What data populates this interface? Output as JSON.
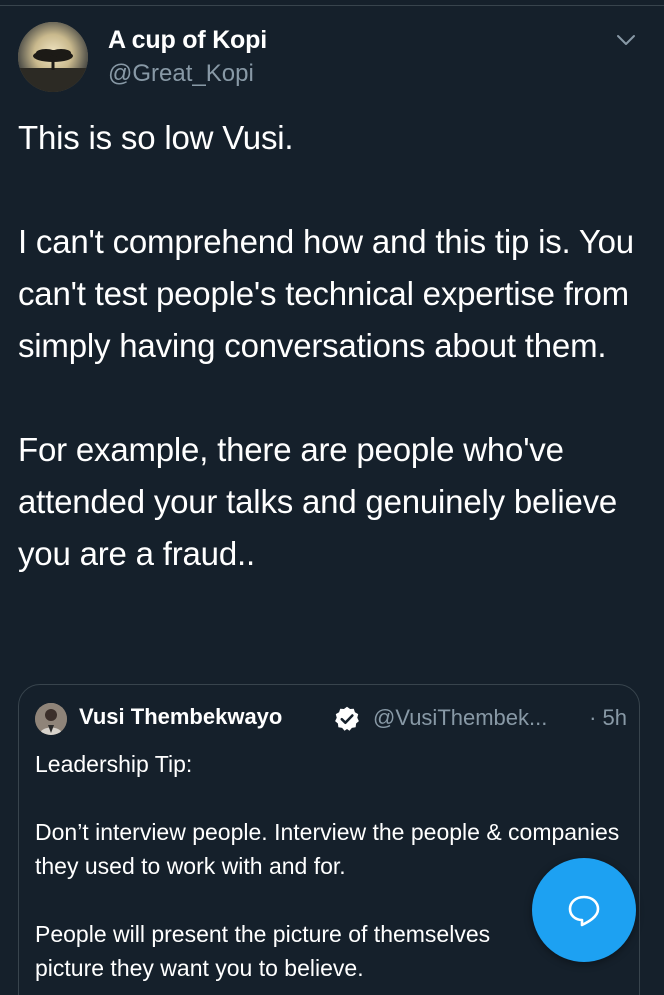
{
  "tweet": {
    "author_name": "A cup of Kopi",
    "author_handle": "@Great_Kopi",
    "paragraphs": [
      "This is so low Vusi.",
      "I can't comprehend how and this tip is. You can't test people's technical expertise from simply having conversations about them.",
      "For example, there are people who've attended your talks and genuinely believe you are a fraud.."
    ]
  },
  "quoted_tweet": {
    "author_name": "Vusi Thembekwayo",
    "author_handle": "@VusiThembek...",
    "time": "· 5h",
    "paragraphs": [
      "Leadership Tip:",
      "Don’t interview people. Interview the people & companies they used to work with and for.",
      "People will present the picture of themselves\npicture they want you to believe."
    ]
  },
  "icons": {
    "menu": "chevron-down-icon",
    "verified": "verified-badge-icon",
    "compose": "compose-reply-icon"
  },
  "colors": {
    "background": "#15202b",
    "secondary_text": "#8899a6",
    "border": "#38444d",
    "accent": "#1da1f2"
  }
}
